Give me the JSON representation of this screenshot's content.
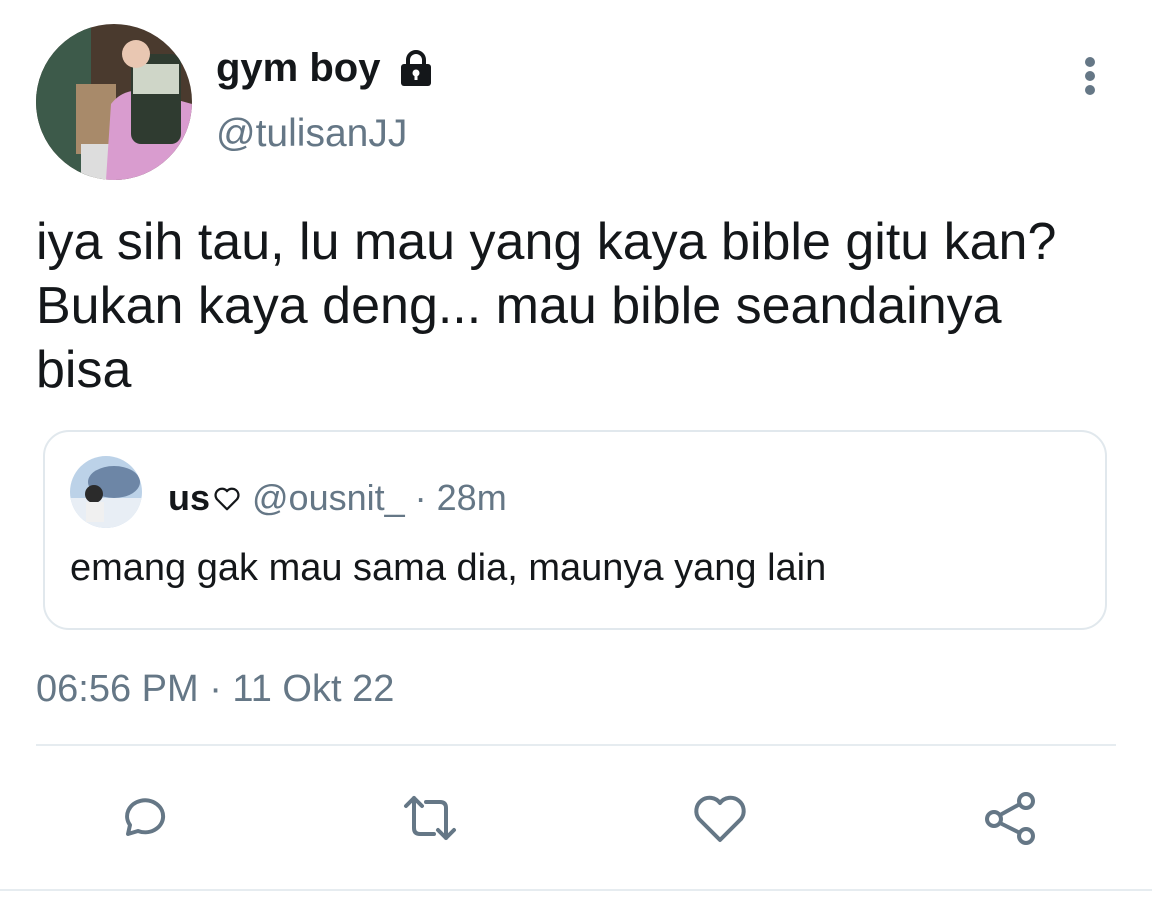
{
  "author": {
    "display_name": "gym boy",
    "handle": "@tulisanJJ",
    "avatar_icon": "user-photo-avatar",
    "protected_icon": "lock-icon"
  },
  "tweet": {
    "text": "iya sih tau, lu mau yang kaya bible gitu kan?\nBukan kaya deng... mau bible seandainya\nbisa",
    "timestamp": "06:56 PM · 11 Okt 22"
  },
  "quoted_tweet": {
    "name": "us",
    "name_icon": "heart-outline-icon",
    "handle": "@ousnit_",
    "separator": "·",
    "time": "28m",
    "text": "emang gak mau sama dia, maunya yang lain"
  },
  "actions": [
    "reply-icon",
    "retweet-icon",
    "like-icon",
    "share-icon"
  ],
  "colors": {
    "text": "#14171a",
    "secondary": "#657786",
    "border": "#e1e8ed"
  }
}
